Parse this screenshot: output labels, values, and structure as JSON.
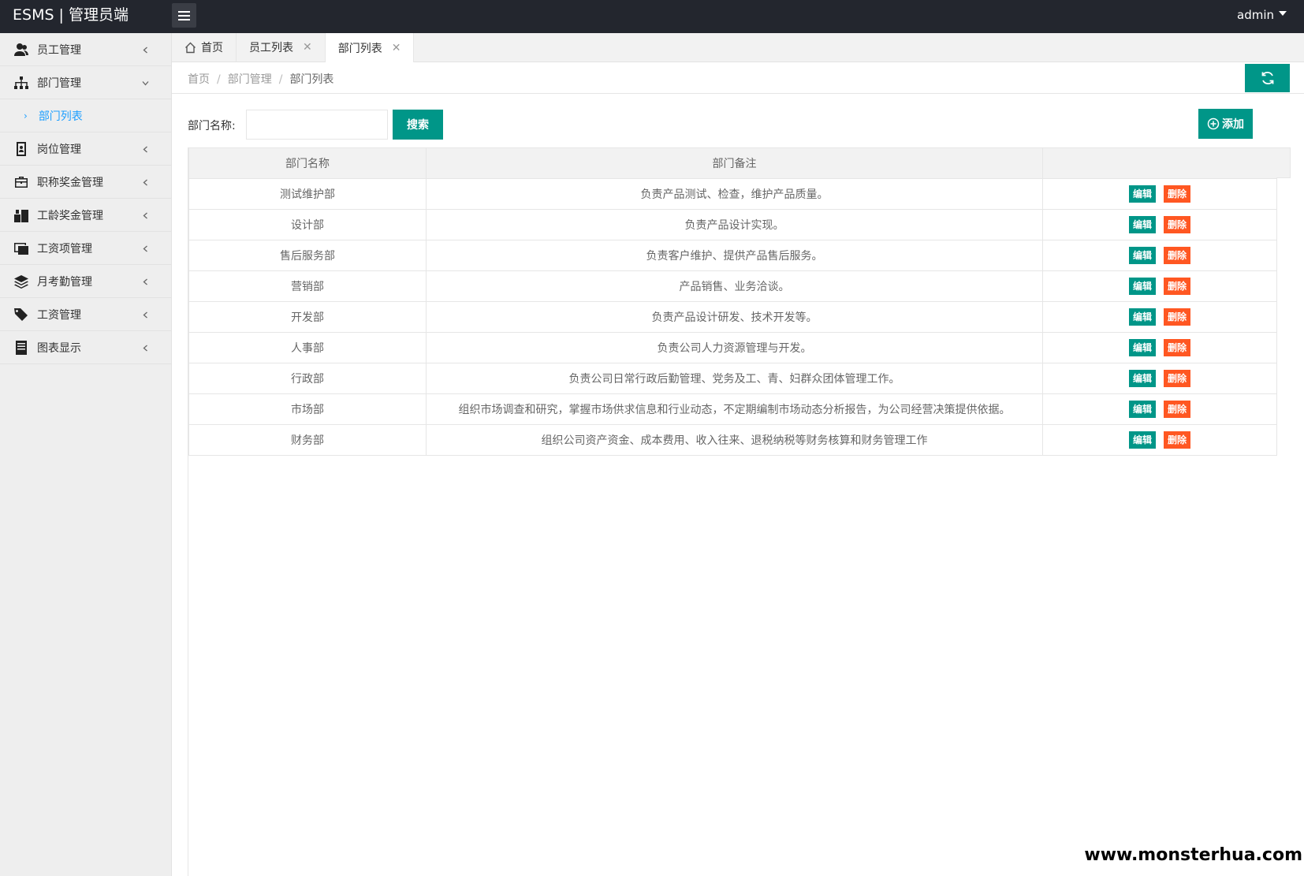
{
  "header": {
    "logo": "ESMS | 管理员端",
    "user": "admin"
  },
  "sidebar": {
    "items": [
      {
        "label": "员工管理",
        "icon": "users-icon",
        "expanded": false
      },
      {
        "label": "部门管理",
        "icon": "sitemap-icon",
        "expanded": true
      },
      {
        "label": "岗位管理",
        "icon": "id-card-icon",
        "expanded": false
      },
      {
        "label": "职称奖金管理",
        "icon": "briefcase-icon",
        "expanded": false
      },
      {
        "label": "工龄奖金管理",
        "icon": "building-icon",
        "expanded": false
      },
      {
        "label": "工资项管理",
        "icon": "money-icon",
        "expanded": false
      },
      {
        "label": "月考勤管理",
        "icon": "layers-icon",
        "expanded": false
      },
      {
        "label": "工资管理",
        "icon": "tags-icon",
        "expanded": false
      },
      {
        "label": "图表显示",
        "icon": "book-icon",
        "expanded": false
      }
    ],
    "sub_item": "部门列表"
  },
  "tabs": [
    {
      "label": "首页",
      "closable": false,
      "active": false
    },
    {
      "label": "员工列表",
      "closable": true,
      "active": false
    },
    {
      "label": "部门列表",
      "closable": true,
      "active": true
    }
  ],
  "breadcrumb": {
    "items": [
      "首页",
      "部门管理",
      "部门列表"
    ],
    "separator": "/"
  },
  "search": {
    "label": "部门名称:",
    "value": "",
    "placeholder": "",
    "button": "搜索"
  },
  "add_button": "添加",
  "table": {
    "columns": [
      "部门名称",
      "部门备注",
      ""
    ],
    "edit_label": "编辑",
    "delete_label": "删除",
    "rows": [
      {
        "name": "测试维护部",
        "desc": "负责产品测试、检查，维护产品质量。"
      },
      {
        "name": "设计部",
        "desc": "负责产品设计实现。"
      },
      {
        "name": "售后服务部",
        "desc": "负责客户维护、提供产品售后服务。"
      },
      {
        "name": "营销部",
        "desc": "产品销售、业务洽谈。"
      },
      {
        "name": "开发部",
        "desc": "负责产品设计研发、技术开发等。"
      },
      {
        "name": "人事部",
        "desc": "负责公司人力资源管理与开发。"
      },
      {
        "name": "行政部",
        "desc": "负责公司日常行政后勤管理、党务及工、青、妇群众团体管理工作。"
      },
      {
        "name": "市场部",
        "desc": "组织市场调查和研究，掌握市场供求信息和行业动态，不定期编制市场动态分析报告，为公司经营决策提供依据。"
      },
      {
        "name": "财务部",
        "desc": "组织公司资产资金、成本费用、收入往来、退税纳税等财务核算和财务管理工作"
      }
    ]
  },
  "watermark": "www.monsterhua.com",
  "colors": {
    "header_bg": "#23262e",
    "primary": "#009688",
    "danger": "#ff5722",
    "active_link": "#1e9fff"
  }
}
